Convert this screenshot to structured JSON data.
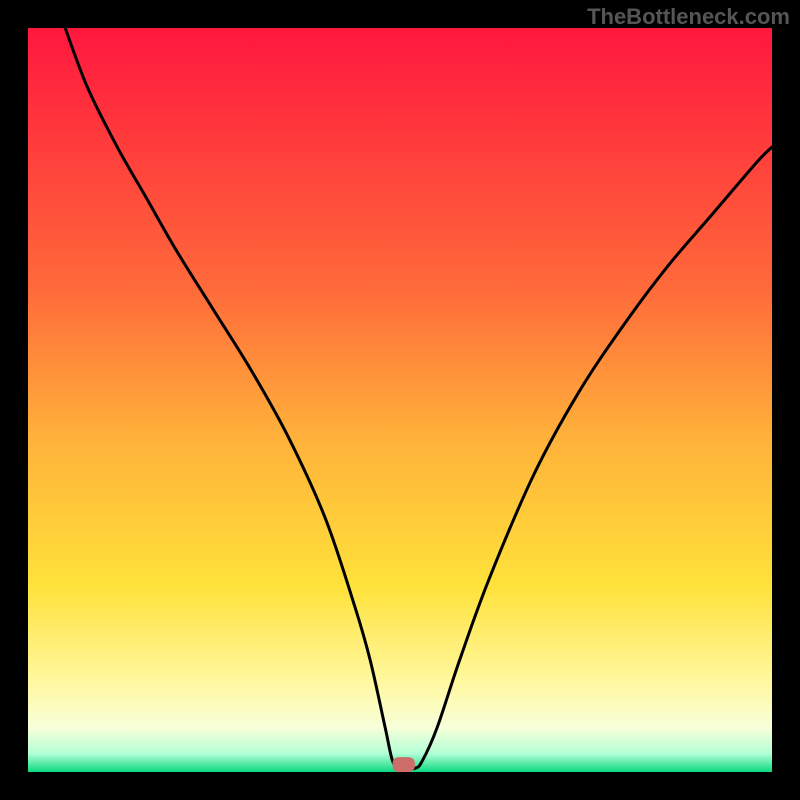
{
  "watermark": "TheBottleneck.com",
  "chart_data": {
    "type": "line",
    "title": "",
    "xlabel": "",
    "ylabel": "",
    "xlim": [
      0,
      100
    ],
    "ylim": [
      0,
      100
    ],
    "grid": false,
    "legend": false,
    "background_gradient": {
      "stops": [
        {
          "offset": 0,
          "color": "#ff173e"
        },
        {
          "offset": 0.35,
          "color": "#ff6a3a"
        },
        {
          "offset": 0.55,
          "color": "#ffb13a"
        },
        {
          "offset": 0.75,
          "color": "#ffe23a"
        },
        {
          "offset": 0.88,
          "color": "#fff8a0"
        },
        {
          "offset": 0.94,
          "color": "#f7ffd9"
        },
        {
          "offset": 0.975,
          "color": "#b3ffd6"
        },
        {
          "offset": 1.0,
          "color": "#0bd980"
        }
      ]
    },
    "marker": {
      "x": 50.5,
      "y": 1.0,
      "width": 3.0,
      "height": 2.0,
      "color": "#cc6d6a"
    },
    "series": [
      {
        "name": "curve",
        "x": [
          5,
          8,
          12,
          16,
          20,
          25,
          30,
          35,
          40,
          44,
          46,
          48,
          49,
          50,
          52,
          53,
          55,
          58,
          62,
          68,
          74,
          80,
          86,
          92,
          98,
          100
        ],
        "values": [
          100,
          92,
          84,
          77,
          70,
          62,
          54,
          45,
          34,
          22,
          15,
          6,
          1.5,
          0.5,
          0.5,
          1.5,
          6,
          15,
          26,
          40,
          51,
          60,
          68,
          75,
          82,
          84
        ]
      }
    ]
  }
}
